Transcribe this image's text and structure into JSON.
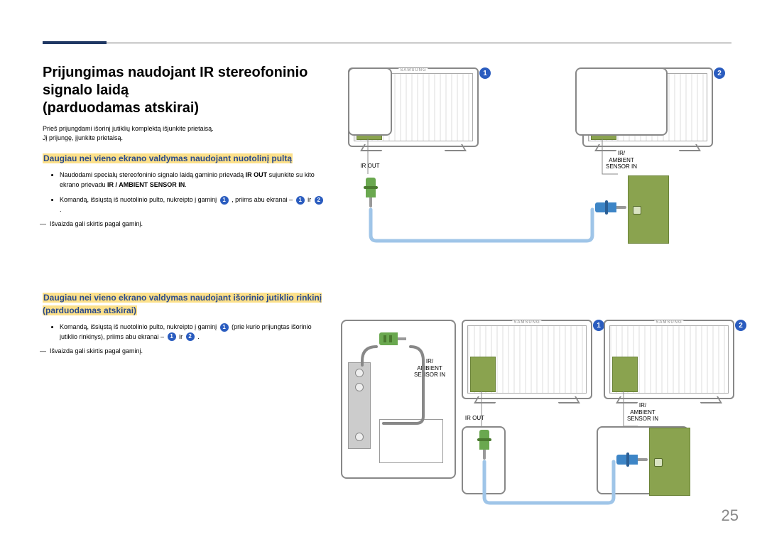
{
  "page_number": "25",
  "title_lines": {
    "l1": "Prijungimas naudojant IR stereofoninio",
    "l2": "signalo laidą",
    "l3": "(parduodamas atskirai)"
  },
  "intro": {
    "p1": "Prieš prijungdami išorinį jutiklių komplektą išjunkite prietaisą.",
    "p2": "Jį prijungę, įjunkite prietaisą."
  },
  "section1": {
    "heading": "Daugiau nei vieno ekrano valdymas naudojant nuotolinį pultą",
    "b1_pre": "Naudodami specialų stereofoninio signalo laidą gaminio prievadą ",
    "b1_bold": "IR OUT",
    "b1_mid": " sujunkite su kito ekrano prievadu ",
    "b1_bold2": "IR / AMBIENT SENSOR IN",
    "b1_post": ".",
    "b2_pre": "Komandą, išsiųstą iš nuotolinio pulto, nukreipto į gaminį ",
    "b2_mid": " , priims abu ekranai – ",
    "b2_and": " ir ",
    "b2_post": " .",
    "note": "Išvaizda gali skirtis pagal gaminį."
  },
  "section2": {
    "heading": "Daugiau nei vieno ekrano valdymas naudojant išorinio jutiklio rinkinį (parduodamas atskirai)",
    "b1_pre": "Komandą, išsiųstą iš nuotolinio pulto, nukreipto į gaminį ",
    "b1_mid": " (prie kurio prijungtas išorinio jutiklio rinkinys), priims abu ekranai – ",
    "b1_and": " ir ",
    "b1_post": " .",
    "note": "Išvaizda gali skirtis pagal gaminį."
  },
  "labels": {
    "ir_out": "IR OUT",
    "ir_ambient_l1": "IR/",
    "ir_ambient_l2": "AMBIENT",
    "ir_ambient_l3": "SENSOR IN",
    "samsung": "SAMSUNG"
  },
  "callouts": {
    "n1": "1",
    "n2": "2"
  }
}
